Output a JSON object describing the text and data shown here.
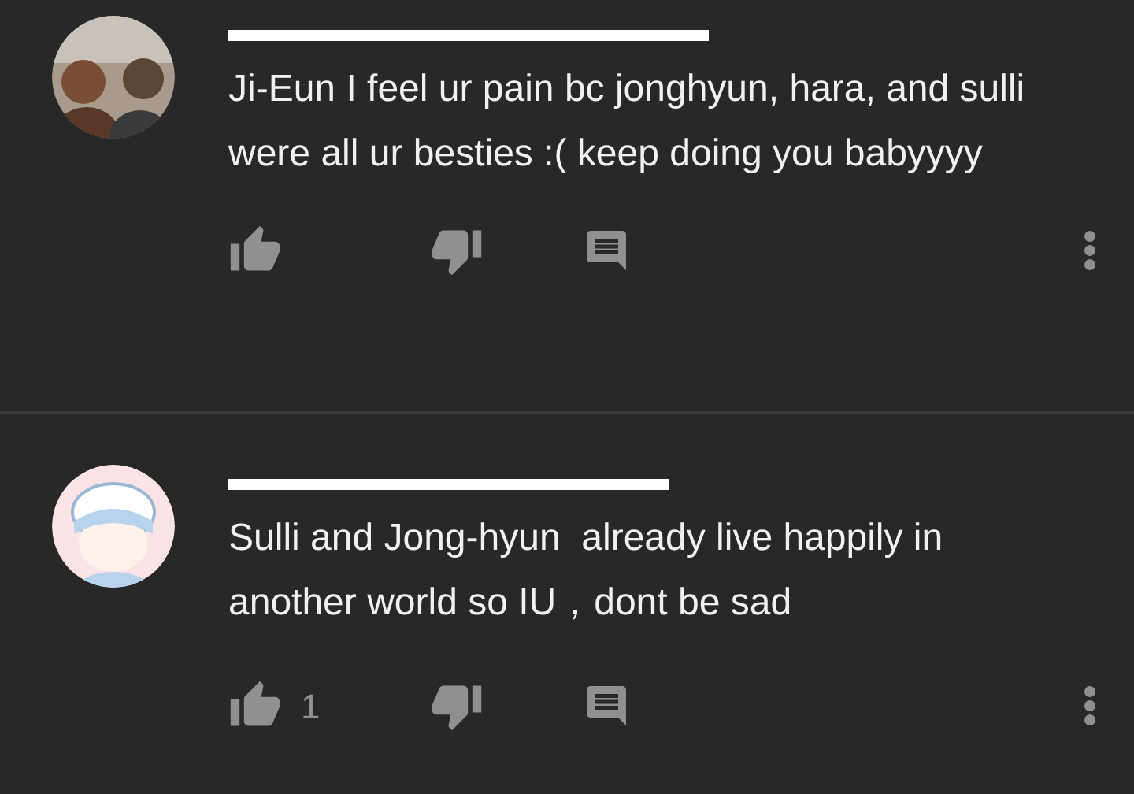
{
  "comments": [
    {
      "text": "Ji-Eun I feel ur pain bc jonghyun, hara, and sulli were all ur besties :( keep doing you babyyyy"
    },
    {
      "text": "Sulli and Jong-hyun  already live happily in another world so IU，dont be sad",
      "likes": "1"
    }
  ]
}
